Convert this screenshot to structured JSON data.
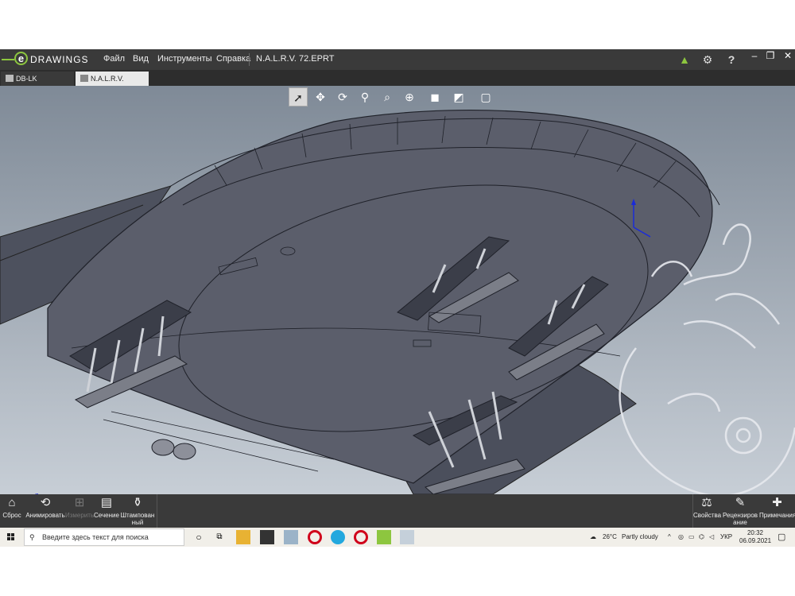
{
  "app": {
    "brand": "DRAWINGS",
    "brand_mark": "e",
    "menu": [
      "Файл",
      "Вид",
      "Инструменты",
      "Справка"
    ],
    "document_title": "N.A.L.R.V. 72.EPRT",
    "title_icons": [
      "upload-arrow-icon",
      "gear-icon",
      "help-icon"
    ],
    "window_buttons": [
      "minimize",
      "restore",
      "close"
    ]
  },
  "tabs": [
    {
      "label": "DB-LK (Parts).eASM",
      "active": false
    },
    {
      "label": "N.A.L.R.V. 72.EPRT",
      "active": true
    }
  ],
  "view_toolbar": [
    "select",
    "pan",
    "rotate",
    "zoom",
    "zoom-to-area",
    "zoom-to-fit",
    "shaded",
    "display-style",
    "view-orientation"
  ],
  "bottom_toolbar": {
    "left": [
      {
        "label": "Сброс",
        "icon": "home-icon",
        "enabled": true
      },
      {
        "label": "Анимировать",
        "icon": "animate-icon",
        "enabled": true
      },
      {
        "label": "Измерить",
        "icon": "measure-icon",
        "enabled": false
      },
      {
        "label": "Сечение",
        "icon": "section-icon",
        "enabled": true
      },
      {
        "label": "Штампованный",
        "icon": "stamp-icon",
        "enabled": true
      }
    ],
    "right": [
      {
        "label": "Свойства",
        "icon": "scales-icon"
      },
      {
        "label": "Рецензирование",
        "icon": "pen-icon"
      },
      {
        "label": "Примечания",
        "icon": "notes-icon"
      }
    ]
  },
  "axes": {
    "x": "X",
    "y": "Y",
    "z": "Z"
  },
  "taskbar": {
    "search_placeholder": "Введите здесь текст для поиска",
    "weather_temp": "26°C",
    "weather_text": "Partly cloudy",
    "language": "УКР",
    "time": "20:32",
    "date": "06.09.2021"
  },
  "colors": {
    "titlebar": "#3a3a3a",
    "brand_green": "#8dc63f",
    "model_fill": "#5a5d6a",
    "viewport_top": "#7f8a97",
    "viewport_bottom": "#c7ced6"
  }
}
